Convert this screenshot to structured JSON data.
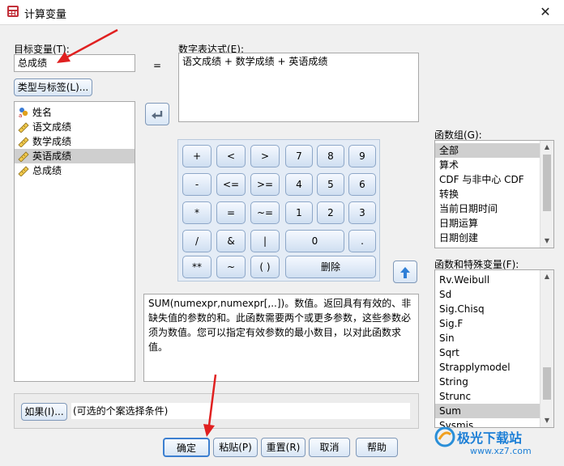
{
  "window": {
    "title": "计算变量",
    "close_glyph": "✕"
  },
  "target_variable": {
    "label": "目标变量(T):",
    "value": "总成绩"
  },
  "equals": "=",
  "type_label_button": "类型与标签(L)...",
  "expression": {
    "label": "数字表达式(E):",
    "value": "语文成绩 + 数学成绩 + 英语成绩"
  },
  "variables": [
    {
      "name": "姓名",
      "icon": "nominal-string-icon"
    },
    {
      "name": "语文成绩",
      "icon": "ruler-icon"
    },
    {
      "name": "数学成绩",
      "icon": "ruler-icon"
    },
    {
      "name": "英语成绩",
      "icon": "ruler-icon",
      "selected": true
    },
    {
      "name": "总成绩",
      "icon": "ruler-icon"
    }
  ],
  "keypad": {
    "plus": "+",
    "lt": "<",
    "gt": ">",
    "k7": "7",
    "k8": "8",
    "k9": "9",
    "minus": "-",
    "le": "<=",
    "ge": ">=",
    "k4": "4",
    "k5": "5",
    "k6": "6",
    "mul": "*",
    "eq": "=",
    "ne": "~=",
    "k1": "1",
    "k2": "2",
    "k3": "3",
    "div": "/",
    "and": "&",
    "or": "|",
    "k0": "0",
    "dot": ".",
    "pow": "**",
    "not": "~",
    "paren": "( )",
    "delete": "删除"
  },
  "function_group": {
    "label": "函数组(G):",
    "items": [
      "全部",
      "算术",
      "CDF 与非中心 CDF",
      "转换",
      "当前日期时间",
      "日期运算",
      "日期创建"
    ],
    "selected_index": 0
  },
  "functions": {
    "label": "函数和特殊变量(F):",
    "items": [
      "Rv.Weibull",
      "Sd",
      "Sig.Chisq",
      "Sig.F",
      "Sin",
      "Sqrt",
      "Strapplymodel",
      "String",
      "Strunc",
      "Sum",
      "Sysmis"
    ],
    "selected_index": 9
  },
  "description": "SUM(numexpr,numexpr[,..])。数值。返回具有有效的、非缺失值的参数的和。此函数需要两个或更多参数，这些参数必须为数值。您可以指定有效参数的最小数目，以对此函数求值。",
  "if_button": "如果(I)...",
  "if_condition": "(可选的个案选择条件)",
  "buttons": {
    "ok": "确定",
    "paste": "粘贴(P)",
    "reset": "重置(R)",
    "cancel": "取消",
    "help": "帮助"
  },
  "watermark": {
    "text": "极光下载站",
    "url": "www.xz7.com"
  }
}
